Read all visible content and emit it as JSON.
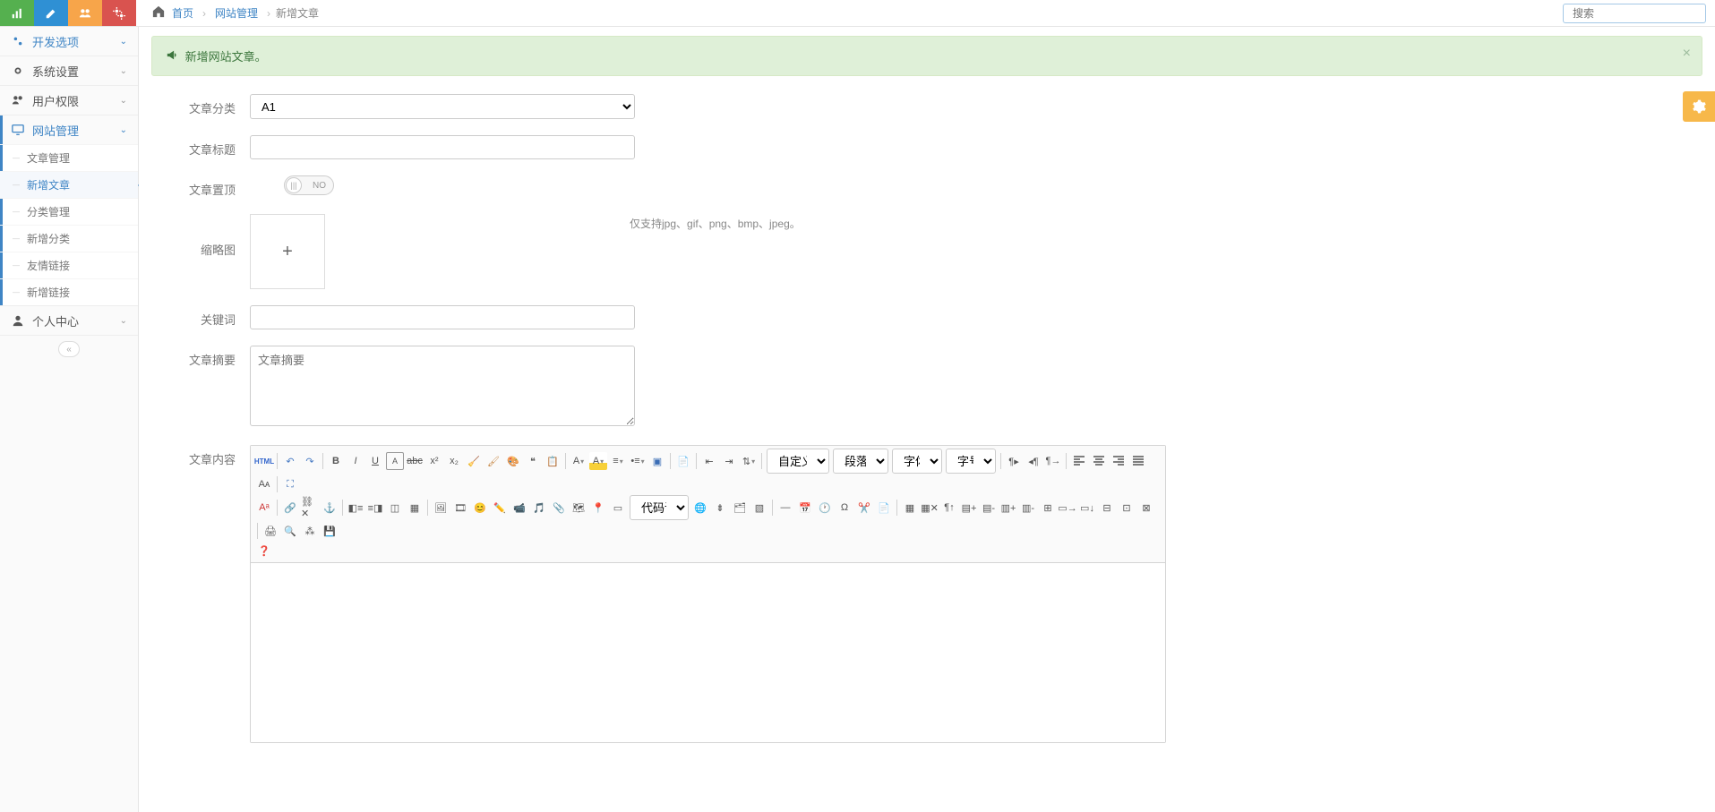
{
  "topbar": {
    "breadcrumb": {
      "home": "首页",
      "section": "网站管理",
      "current": "新增文章"
    },
    "search_placeholder": "搜索"
  },
  "sidebar": {
    "dev": "开发选项",
    "sys": "系统设置",
    "user": "用户权限",
    "site": "网站管理",
    "site_items": {
      "article_mgmt": "文章管理",
      "new_article": "新增文章",
      "cat_mgmt": "分类管理",
      "new_cat": "新增分类",
      "links": "友情链接",
      "new_link": "新增链接"
    },
    "personal": "个人中心"
  },
  "alert": {
    "text": "新增网站文章。"
  },
  "form": {
    "category_label": "文章分类",
    "category_value": "A1",
    "title_label": "文章标题",
    "sticky_label": "文章置顶",
    "sticky_no": "NO",
    "thumb_label": "缩略图",
    "thumb_help": "仅支持jpg、gif、png、bmp、jpeg。",
    "keywords_label": "关键词",
    "summary_label": "文章摘要",
    "summary_placeholder": "文章摘要",
    "content_label": "文章内容"
  },
  "editor": {
    "custom_title": "自定义标题",
    "para_format": "段落格式",
    "font_family": "字体",
    "font_size": "字号",
    "code_lang": "代码语言"
  }
}
